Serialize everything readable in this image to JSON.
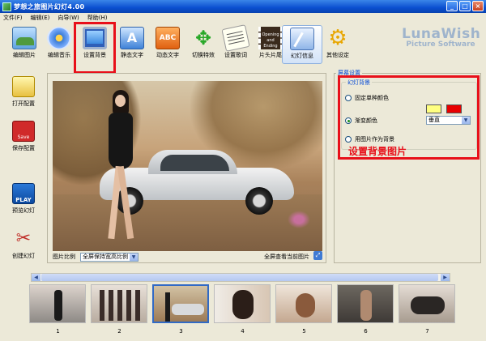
{
  "window": {
    "title": "梦想之旅图片幻灯4.00"
  },
  "menu": [
    "文件(F)",
    "编辑(E)",
    "向导(W)",
    "帮助(H)"
  ],
  "toolbar": {
    "items": [
      {
        "label": "编辑图片",
        "icon": "edit-picture-icon"
      },
      {
        "label": "编辑音乐",
        "icon": "edit-music-icon"
      },
      {
        "label": "设置背景",
        "icon": "set-background-icon"
      },
      {
        "label": "静态文字",
        "icon": "static-text-icon"
      },
      {
        "label": "动态文字",
        "icon": "dynamic-text-icon"
      },
      {
        "label": "切换特效",
        "icon": "transition-effect-icon"
      },
      {
        "label": "设置歌词",
        "icon": "lyrics-icon"
      },
      {
        "label": "片头片尾",
        "icon": "opening-ending-icon"
      },
      {
        "label": "幻灯信息",
        "icon": "slideshow-info-icon"
      },
      {
        "label": "其他设定",
        "icon": "other-settings-icon"
      }
    ],
    "opening_text": "Opening and Ending"
  },
  "brand": {
    "name": "LunaWish",
    "subtitle": "Picture Software"
  },
  "sidebar": [
    {
      "label": "打开配置",
      "icon": "open-config-icon"
    },
    {
      "label": "保存配置",
      "icon": "save-config-icon",
      "icon_text": "Save"
    },
    {
      "label": "预览幻灯",
      "icon": "preview-slideshow-icon",
      "icon_text": "PLAY"
    },
    {
      "label": "创建幻灯",
      "icon": "create-slideshow-icon"
    }
  ],
  "preview": {
    "ratio_label": "图片比例",
    "ratio_value": "全屏保持宽高比例",
    "fullscreen_label": "全屏查看当前图片"
  },
  "settings": {
    "section_title": "屏幕设置",
    "group_title": "幻灯背景",
    "options": [
      {
        "label": "固定单种颜色",
        "selected": false
      },
      {
        "label": "渐变颜色",
        "selected": true
      },
      {
        "label": "用图片作为背景",
        "selected": false
      }
    ],
    "color1": "#ffff80",
    "color2": "#e80000",
    "gradient_direction": "垂直"
  },
  "annotation": "设置背景图片",
  "thumbnails": [
    {
      "num": "1",
      "selected": false
    },
    {
      "num": "2",
      "selected": false
    },
    {
      "num": "3",
      "selected": true
    },
    {
      "num": "4",
      "selected": false
    },
    {
      "num": "5",
      "selected": false
    },
    {
      "num": "6",
      "selected": false
    },
    {
      "num": "7",
      "selected": false
    }
  ]
}
